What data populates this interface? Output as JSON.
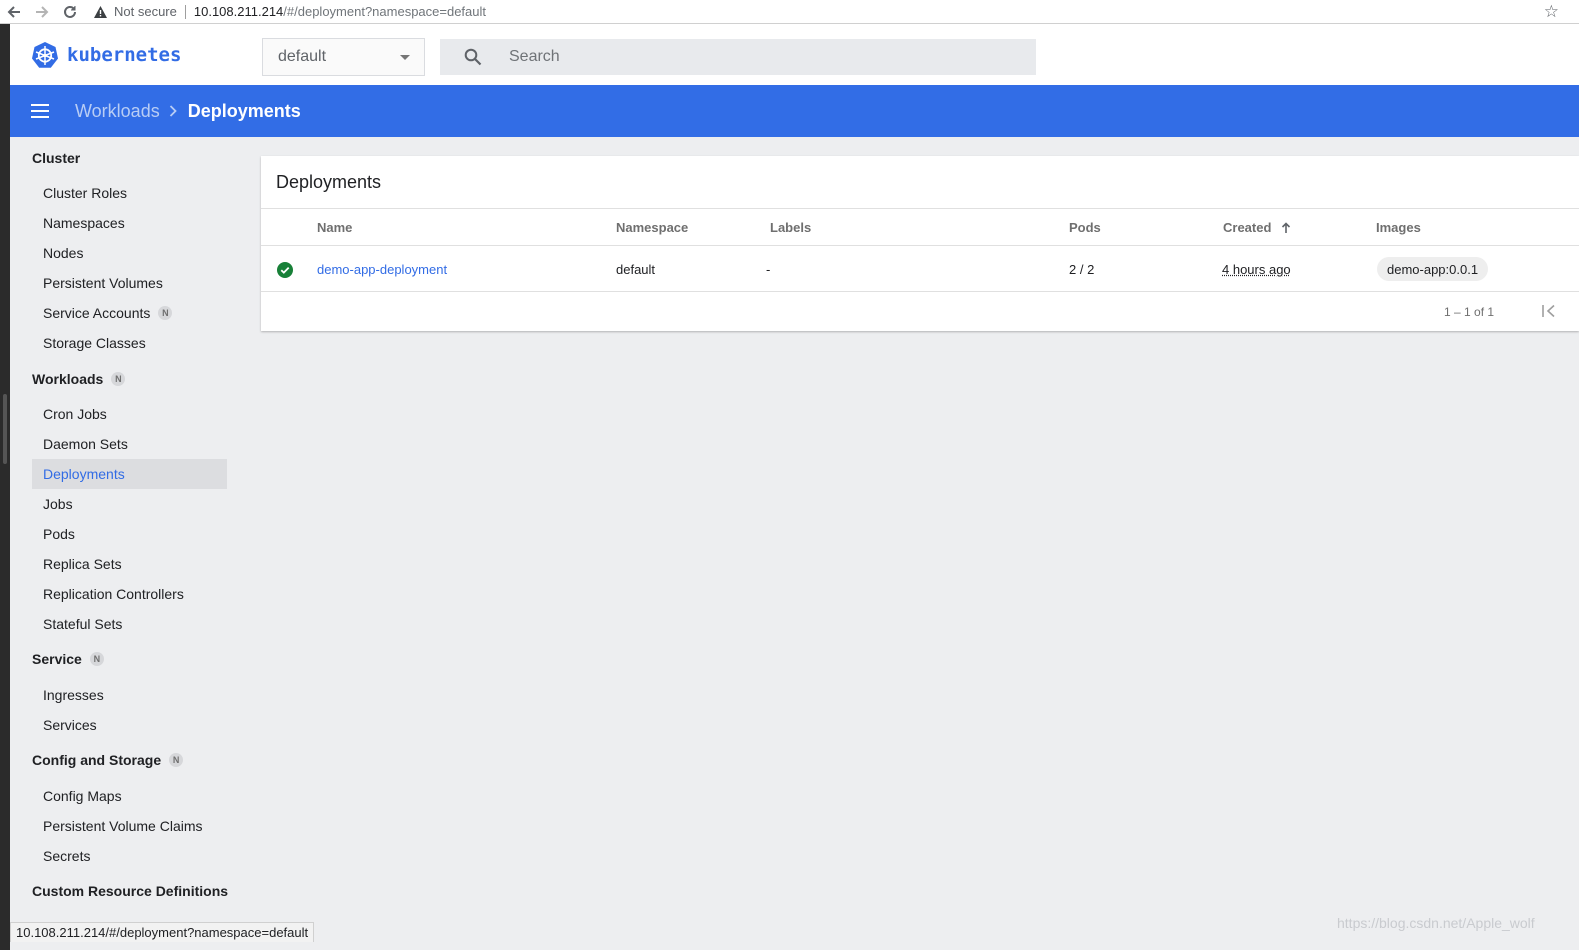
{
  "browser": {
    "back_icon": "arrow-left-icon",
    "forward_icon": "arrow-right-icon",
    "reload_icon": "reload-icon",
    "security_text": "Not secure",
    "url_host": "10.108.211.214",
    "url_rest": "/#/deployment?namespace=default",
    "bookmark_icon": "star-icon"
  },
  "header": {
    "logo_text": "kubernetes",
    "namespace_value": "default",
    "search_placeholder": "Search"
  },
  "breadcrumb": {
    "parent": "Workloads",
    "current": "Deployments"
  },
  "sidebar": {
    "groups": [
      {
        "label": "Cluster",
        "badge": ""
      },
      {
        "label": "Workloads",
        "badge": "N"
      },
      {
        "label": "Service",
        "badge": "N"
      },
      {
        "label": "Config and Storage",
        "badge": "N"
      },
      {
        "label": "Custom Resource Definitions",
        "badge": ""
      }
    ],
    "cluster_items": [
      "Cluster Roles",
      "Namespaces",
      "Nodes",
      "Persistent Volumes",
      "Service Accounts",
      "Storage Classes"
    ],
    "service_accounts_badge": "N",
    "workload_items": [
      "Cron Jobs",
      "Daemon Sets",
      "Deployments",
      "Jobs",
      "Pods",
      "Replica Sets",
      "Replication Controllers",
      "Stateful Sets"
    ],
    "service_items": [
      "Ingresses",
      "Services"
    ],
    "config_items": [
      "Config Maps",
      "Persistent Volume Claims",
      "Secrets"
    ],
    "active_item": "Deployments"
  },
  "main": {
    "card_title": "Deployments",
    "columns": [
      "Name",
      "Namespace",
      "Labels",
      "Pods",
      "Created",
      "Images"
    ],
    "sort_icon": "arrow-up-icon",
    "rows": [
      {
        "status": "running",
        "name": "demo-app-deployment",
        "namespace": "default",
        "labels": "-",
        "pods": "2 / 2",
        "created": "4 hours ago",
        "image": "demo-app:0.0.1"
      }
    ],
    "pagination": "1 – 1 of 1"
  },
  "statusbar": {
    "url": "10.108.211.214/#/deployment?namespace=default"
  },
  "watermark": "https://blog.csdn.net/Apple_wolf",
  "colors": {
    "accent": "#326ce5",
    "success": "#188038"
  }
}
